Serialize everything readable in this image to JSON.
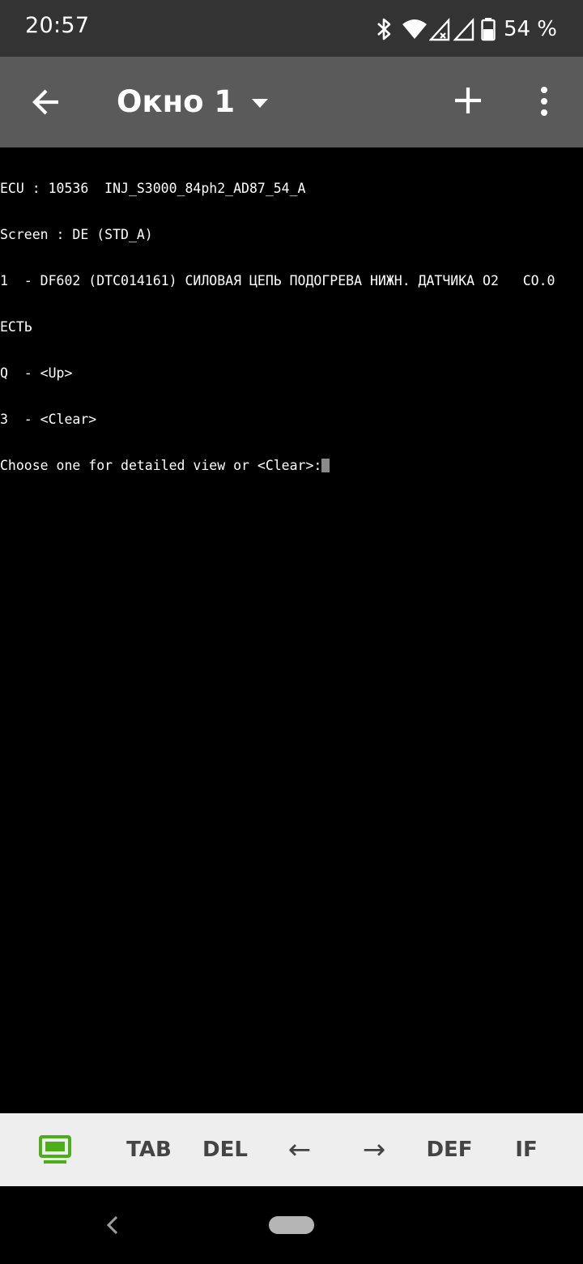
{
  "status_bar": {
    "time": "20:57",
    "battery_percent": "54 %",
    "icons": [
      "bluetooth-icon",
      "wifi-icon",
      "signal-icon",
      "signal-icon",
      "battery-icon"
    ]
  },
  "app_bar": {
    "title": "Окно 1",
    "icons": [
      "back-arrow-icon",
      "dropdown-icon",
      "plus-icon",
      "more-vert-icon"
    ]
  },
  "terminal": {
    "lines": [
      "ECU : 10536  INJ_S3000_84ph2_AD87_54_A",
      "Screen : DE (STD_A)",
      "1  - DF602 (DTC014161) СИЛОВАЯ ЦЕПЬ ПОДОГРЕВА НИЖН. ДАТЧИКА О2   CO.0",
      "ЕСТЬ",
      "Q  - <Up>",
      "3  - <Clear>",
      "Choose one for detailed view or <Clear>:"
    ]
  },
  "keybar": {
    "keys": [
      "TAB",
      "DEL",
      "←",
      "→",
      "DEF",
      "IF"
    ],
    "accent_color": "#4caf1a"
  },
  "nav_bar": {
    "icons": [
      "nav-back-icon",
      "nav-home-pill"
    ]
  }
}
